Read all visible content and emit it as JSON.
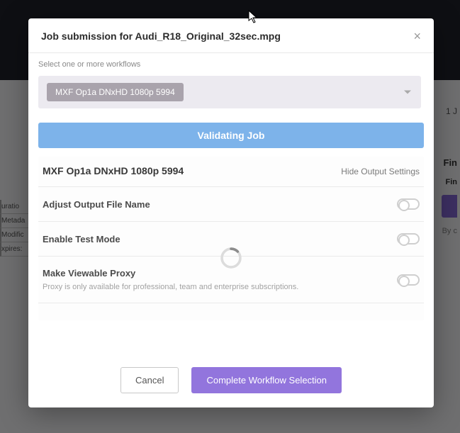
{
  "background": {
    "jobs_label": "1 J",
    "fin_heading": "Fin",
    "final_label": "Fin",
    "byc_label": "By c",
    "left_items": [
      "uratio",
      "Metada",
      "Modific",
      "xpires:"
    ]
  },
  "modal": {
    "title": "Job submission for Audi_R18_Original_32sec.mpg",
    "close_glyph": "×",
    "subtitle": "Select one or more workflows",
    "selected_workflow": "MXF Op1a DNxHD 1080p 5994",
    "status_text": "Validating Job",
    "section": {
      "title": "MXF Op1a DNxHD 1080p 5994",
      "toggle_link": "Hide Output Settings"
    },
    "settings": [
      {
        "label": "Adjust Output File Name",
        "sub": "",
        "on": false
      },
      {
        "label": "Enable Test Mode",
        "sub": "",
        "on": false
      },
      {
        "label": "Make Viewable Proxy",
        "sub": "Proxy is only available for professional, team and enterprise subscriptions.",
        "on": false
      }
    ],
    "footer": {
      "cancel": "Cancel",
      "complete": "Complete Workflow Selection"
    }
  }
}
